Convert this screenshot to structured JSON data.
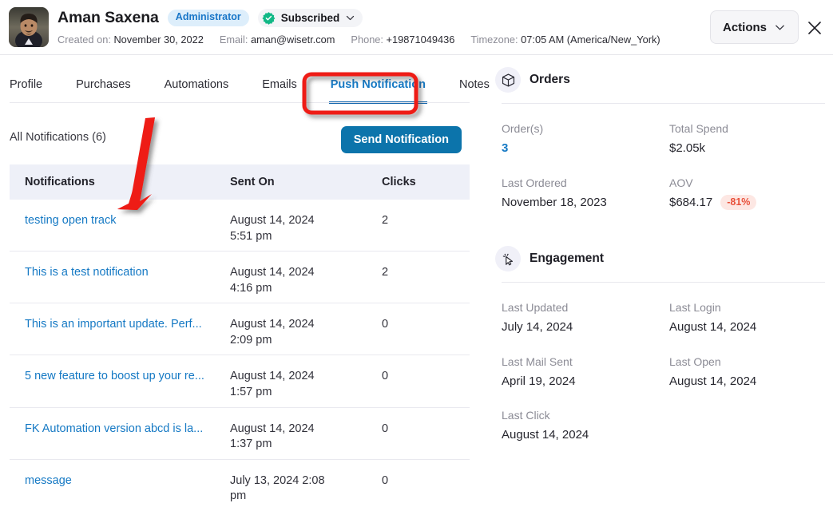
{
  "header": {
    "name": "Aman Saxena",
    "role_badge": "Administrator",
    "subscription_status": "Subscribed",
    "subscribed_icon": "verified-check-icon",
    "subscribed_chevron_icon": "chevron-down-icon",
    "avatar_icon": "user-avatar-photo",
    "meta": [
      {
        "key": "Created on:",
        "value": "November 30, 2022"
      },
      {
        "key": "Email:",
        "value": "aman@wisetr.com"
      },
      {
        "key": "Phone:",
        "value": "+19871049436"
      },
      {
        "key": "Timezone:",
        "value": "07:05 AM (America/New_York)"
      }
    ],
    "actions_label": "Actions",
    "actions_chevron_icon": "chevron-down-icon",
    "close_icon": "close-icon"
  },
  "tabs": {
    "items": [
      {
        "label": "Profile",
        "active": false
      },
      {
        "label": "Purchases",
        "active": false
      },
      {
        "label": "Automations",
        "active": false
      },
      {
        "label": "Emails",
        "active": false
      },
      {
        "label": "Push Notification",
        "active": true
      },
      {
        "label": "Notes",
        "active": false
      }
    ],
    "active_label": "Push Notification"
  },
  "notifications_panel": {
    "count_label": "All Notifications (6)",
    "send_button": "Send Notification",
    "columns": [
      "Notifications",
      "Sent On",
      "Clicks"
    ],
    "rows": [
      {
        "title": "testing open track",
        "sent_on": "August 14, 2024 5:51 pm",
        "clicks": "2"
      },
      {
        "title": "This is a test notification",
        "sent_on": "August 14, 2024 4:16 pm",
        "clicks": "2"
      },
      {
        "title": "This is an important update. Perf...",
        "sent_on": "August 14, 2024 2:09 pm",
        "clicks": "0"
      },
      {
        "title": "5 new feature to boost up your re...",
        "sent_on": "August 14, 2024 1:57 pm",
        "clicks": "0"
      },
      {
        "title": "FK Automation version abcd is la...",
        "sent_on": "August 14, 2024 1:37 pm",
        "clicks": "0"
      },
      {
        "title": "message",
        "sent_on": "July 13, 2024 2:08 pm",
        "clicks": "0"
      }
    ]
  },
  "orders": {
    "title": "Orders",
    "icon": "package-box-icon",
    "fields": [
      {
        "key": "Order(s)",
        "value": "3"
      },
      {
        "key": "Total Spend",
        "value": "$2.05k"
      },
      {
        "key": "Last Ordered",
        "value": "November 18, 2023"
      },
      {
        "key": "AOV",
        "value": "$684.17",
        "badge": "-81%"
      }
    ]
  },
  "engagement": {
    "title": "Engagement",
    "icon": "click-cursor-icon",
    "fields": [
      {
        "key": "Last Updated",
        "value": "July 14, 2024"
      },
      {
        "key": "Last Login",
        "value": "August 14, 2024"
      },
      {
        "key": "Last Mail Sent",
        "value": "April 19, 2024"
      },
      {
        "key": "Last Open",
        "value": "August 14, 2024"
      },
      {
        "key": "Last Click",
        "value": "August 14, 2024"
      }
    ]
  },
  "annotations": {
    "highlight_color": "#ee1c16",
    "arrow_icon": "red-arrow-annotation",
    "box_icon": "red-highlight-box-annotation"
  },
  "colors": {
    "accent_blue": "#1579c4",
    "button_blue": "#0c74ab",
    "badge_blue_bg": "#ddeefb",
    "table_header_bg": "#eef0f8",
    "negative_red": "#e8503a",
    "annotation_red": "#ee1c16"
  }
}
